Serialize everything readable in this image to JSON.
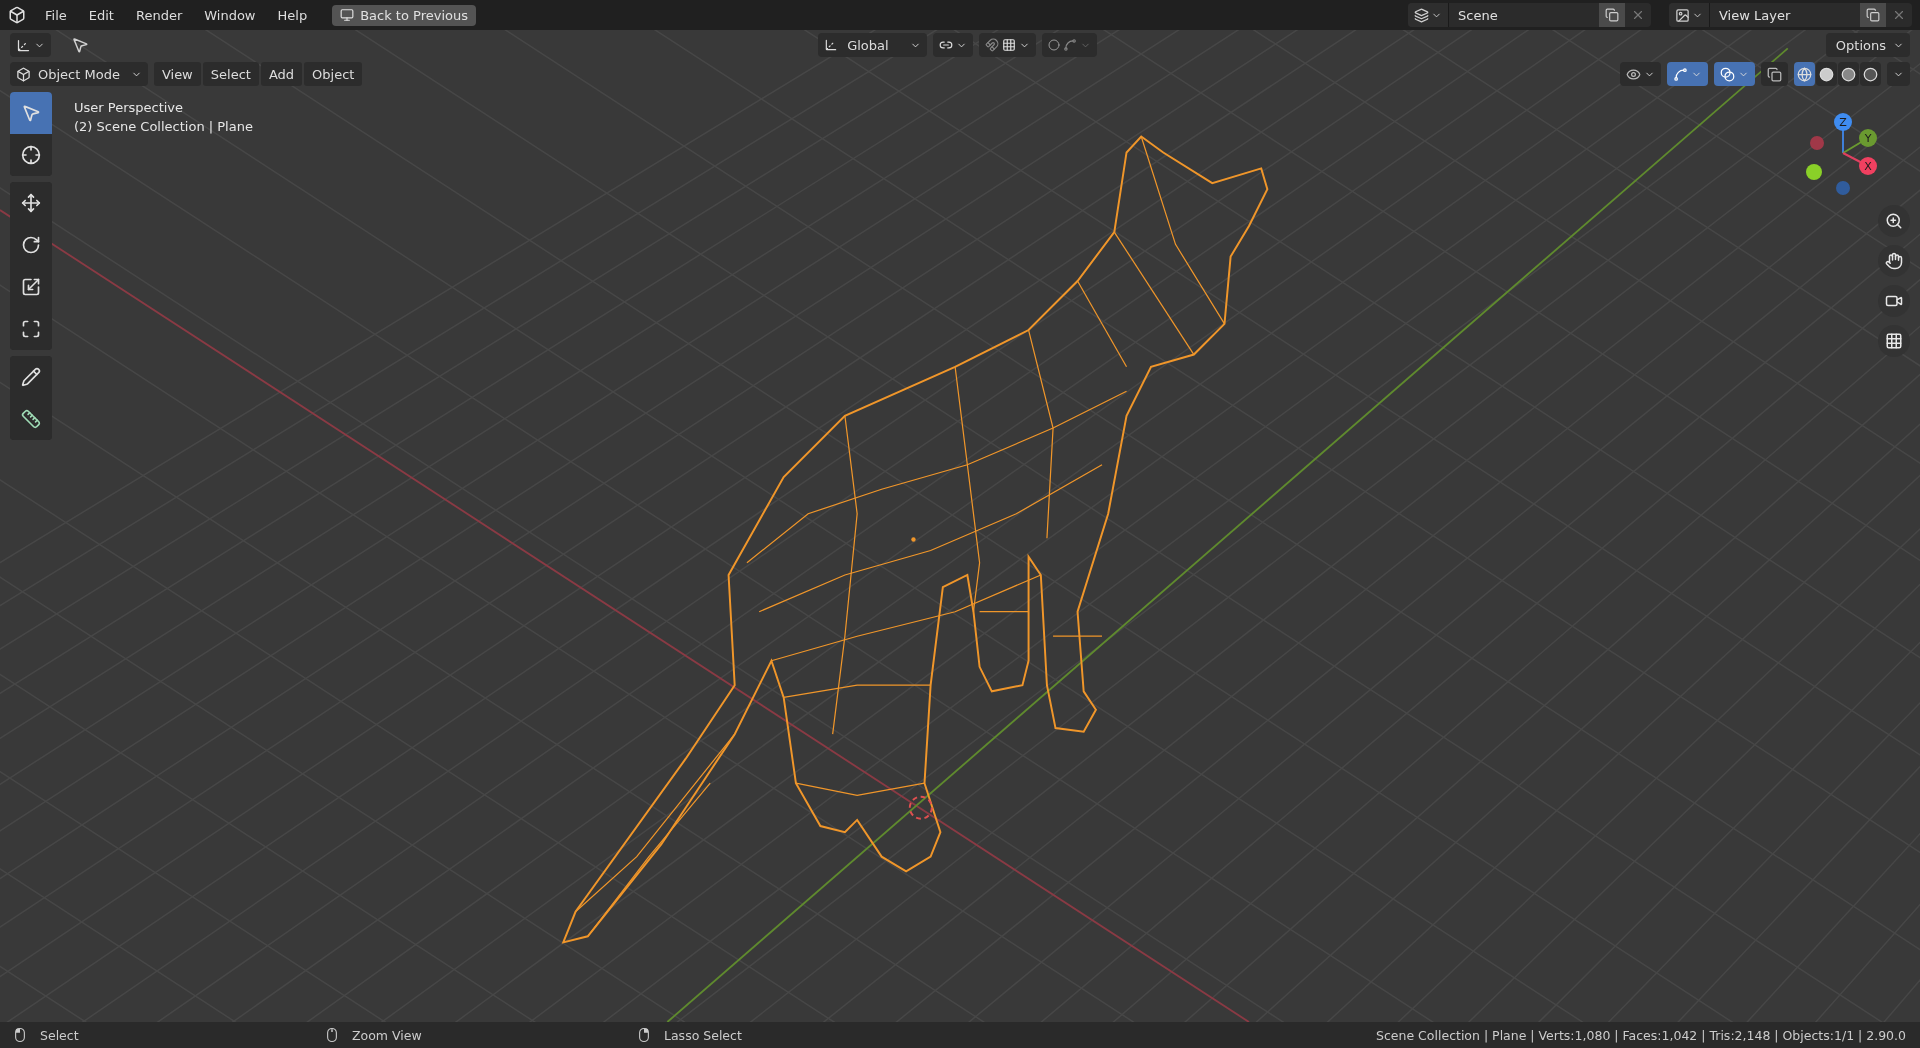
{
  "menu": [
    "File",
    "Edit",
    "Render",
    "Window",
    "Help"
  ],
  "back_button": "Back to Previous",
  "scene": {
    "label": "Scene"
  },
  "view_layer": {
    "label": "View Layer"
  },
  "tool_header": {
    "orientation": "Global",
    "snap": {
      "on": false
    },
    "proportional": {
      "on": false
    },
    "options": "Options"
  },
  "viewport_header": {
    "mode": "Object Mode",
    "items": [
      "View",
      "Select",
      "Add",
      "Object"
    ],
    "toggles": [
      {
        "kind": "visibility",
        "on": false
      },
      {
        "kind": "gizmos",
        "on": true
      },
      {
        "kind": "overlays",
        "on": true
      },
      {
        "kind": "xray",
        "on": false
      }
    ],
    "shading": [
      {
        "kind": "wireframe",
        "selected": true
      },
      {
        "kind": "solid",
        "selected": false
      },
      {
        "kind": "material",
        "selected": false
      },
      {
        "kind": "rendered",
        "selected": false
      }
    ]
  },
  "tools": [
    {
      "kind": "select",
      "selected": true
    },
    {
      "kind": "cursor",
      "selected": false
    },
    {
      "kind": "move",
      "selected": false
    },
    {
      "kind": "rotate",
      "selected": false
    },
    {
      "kind": "scale",
      "selected": false
    },
    {
      "kind": "transform",
      "selected": false
    },
    {
      "kind": "annotate",
      "selected": false
    },
    {
      "kind": "measure",
      "selected": false
    }
  ],
  "overlay_text": [
    "User Perspective",
    "(2) Scene Collection | Plane"
  ],
  "gizmo_axes": [
    "Z",
    "Y",
    "X"
  ],
  "nav_buttons": [
    {
      "kind": "zoom"
    },
    {
      "kind": "pan"
    },
    {
      "kind": "camera"
    },
    {
      "kind": "ortho"
    }
  ],
  "status": {
    "hints": [
      {
        "kind": "left",
        "label": "Select"
      },
      {
        "kind": "middle",
        "label": "Zoom View"
      },
      {
        "kind": "right",
        "label": "Lasso Select"
      }
    ],
    "stats": "Scene Collection | Plane | Verts:1,080 | Faces:1,042 | Tris:2,148 | Objects:1/1 | 2.90.0"
  }
}
